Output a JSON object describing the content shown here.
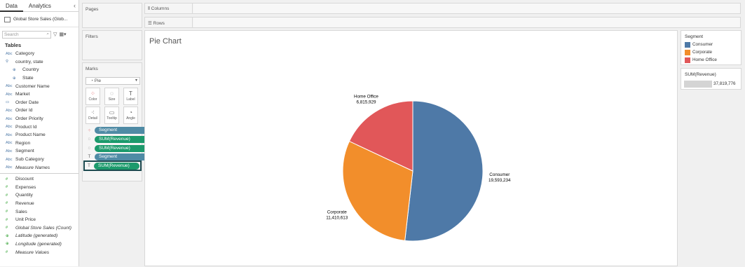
{
  "data_pane": {
    "tabs": [
      {
        "label": "Data"
      },
      {
        "label": "Analytics"
      }
    ],
    "collapse": "‹",
    "datasource": "Global Store Sales (Glob...",
    "search_placeholder": "Search",
    "tables_heading": "Tables",
    "fields": [
      {
        "icon": "Abc",
        "label": "Category"
      },
      {
        "icon": "⚲",
        "label": "country, state"
      },
      {
        "icon": "⊕",
        "label": "Country"
      },
      {
        "icon": "⊕",
        "label": "State"
      },
      {
        "icon": "Abc",
        "label": "Customer Name"
      },
      {
        "icon": "Abc",
        "label": "Market"
      },
      {
        "icon": "▭",
        "label": "Order Date"
      },
      {
        "icon": "Abc",
        "label": "Order Id"
      },
      {
        "icon": "Abc",
        "label": "Order Priority"
      },
      {
        "icon": "Abc",
        "label": "Product Id"
      },
      {
        "icon": "Abc",
        "label": "Product Name"
      },
      {
        "icon": "Abc",
        "label": "Region"
      },
      {
        "icon": "Abc",
        "label": "Segment"
      },
      {
        "icon": "Abc",
        "label": "Sub Category"
      },
      {
        "icon": "Abc",
        "label": "Measure Names"
      }
    ],
    "measures": [
      {
        "icon": "#",
        "label": "Discount"
      },
      {
        "icon": "#",
        "label": "Expenses"
      },
      {
        "icon": "#",
        "label": "Quantity"
      },
      {
        "icon": "#",
        "label": "Revenue"
      },
      {
        "icon": "#",
        "label": "Sales"
      },
      {
        "icon": "#",
        "label": "Unit Price"
      },
      {
        "icon": "#",
        "label": "Global Store Sales (Count)"
      },
      {
        "icon": "⊕",
        "label": "Latitude (generated)"
      },
      {
        "icon": "⊕",
        "label": "Longitude (generated)"
      },
      {
        "icon": "#",
        "label": "Measure Values"
      }
    ]
  },
  "shelves": {
    "pages": "Pages",
    "filters": "Filters",
    "marks": "Marks",
    "columns": "Columns",
    "rows": "Rows"
  },
  "marks": {
    "type": "Pie",
    "buttons": [
      {
        "icon": "⁘",
        "label": "Color"
      },
      {
        "icon": "◌",
        "label": "Size"
      },
      {
        "icon": "T",
        "label": "Label"
      },
      {
        "icon": "⁖",
        "label": "Detail"
      },
      {
        "icon": "▭",
        "label": "Tooltip"
      },
      {
        "icon": "◔",
        "label": "Angle"
      }
    ],
    "pills": [
      {
        "icon": "⁘",
        "label": "Segment",
        "kind": "dim"
      },
      {
        "icon": "◌",
        "label": "SUM(Revenue)",
        "kind": "meas"
      },
      {
        "icon": "◌",
        "label": "SUM(Revenue)",
        "kind": "meas"
      },
      {
        "icon": "T",
        "label": "Segment",
        "kind": "dim"
      },
      {
        "icon": "T",
        "label": "SUM(Revenue)",
        "kind": "meas"
      }
    ]
  },
  "view": {
    "title": "Pie Chart"
  },
  "chart_data": {
    "type": "pie",
    "slices": [
      {
        "label": "Consumer",
        "value": 19593234,
        "value_label": "19,593,234",
        "color": "#4e79a7"
      },
      {
        "label": "Corporate",
        "value": 11410613,
        "value_label": "11,410,613",
        "color": "#f28e2b"
      },
      {
        "label": "Home Office",
        "value": 6815929,
        "value_label": "6,815,929",
        "color": "#e15759"
      }
    ]
  },
  "legend": {
    "title": "Segment",
    "items": [
      {
        "label": "Consumer",
        "color": "#4e79a7"
      },
      {
        "label": "Corporate",
        "color": "#f28e2b"
      },
      {
        "label": "Home Office",
        "color": "#e15759"
      }
    ]
  },
  "size_legend": {
    "title": "SUM(Revenue)",
    "value": "37,819,776"
  }
}
